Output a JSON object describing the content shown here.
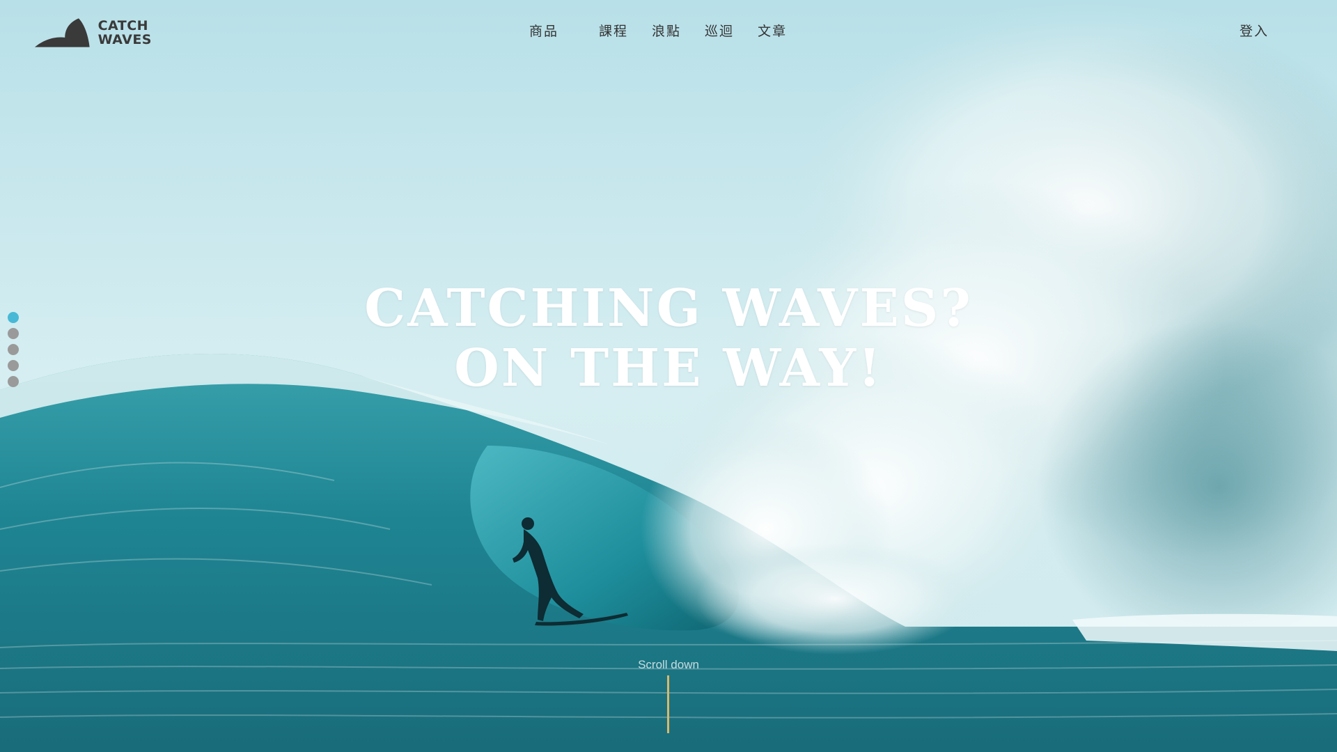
{
  "brand": {
    "name_line1": "CATCH",
    "name_line2": "WAVES",
    "logo_icon": "wave-fin-icon",
    "logo_color": "#3a3a3a"
  },
  "nav": {
    "items": [
      {
        "label": "商品"
      },
      {
        "label": "課程"
      },
      {
        "label": "浪點"
      },
      {
        "label": "巡迴"
      },
      {
        "label": "文章"
      }
    ],
    "login_label": "登入"
  },
  "hero": {
    "headline_line1": "CATCHING WAVES?",
    "headline_line2": "ON THE WAY!",
    "scroll_label": "Scroll down",
    "accent_color": "#47b9d6",
    "scroll_line_color": "#d9b96a"
  },
  "pagination": {
    "count": 5,
    "active_index": 0
  }
}
